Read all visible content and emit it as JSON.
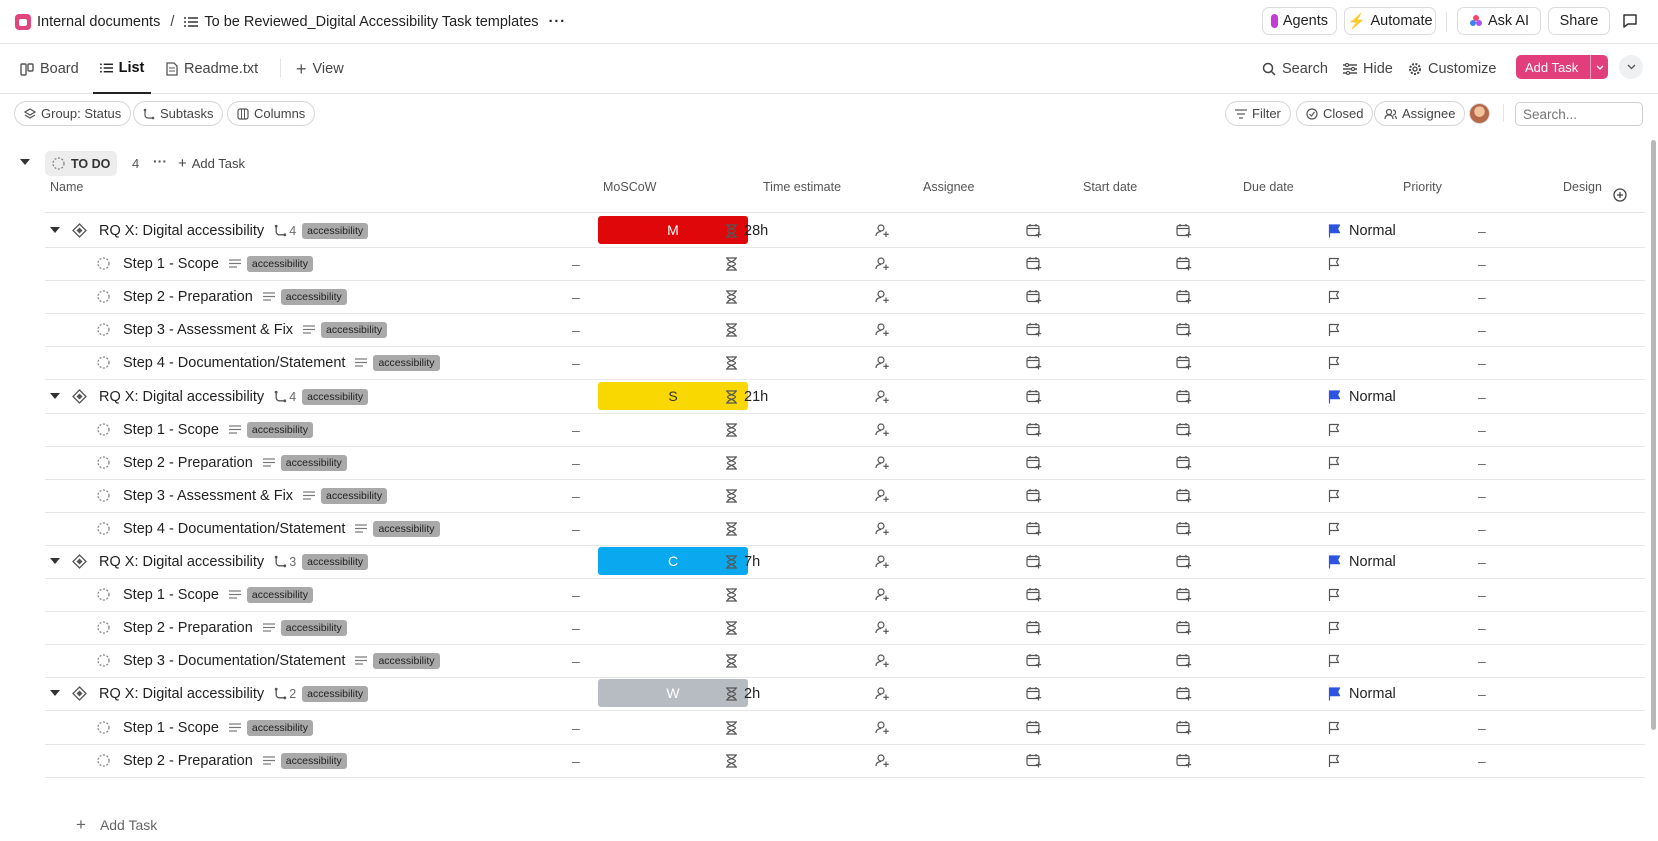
{
  "breadcrumb": {
    "workspace": "Internal documents",
    "separator": "/",
    "list": "To be Reviewed_Digital Accessibility Task templates",
    "more": "···"
  },
  "topbar": {
    "agents": "Agents",
    "automate": "Automate",
    "ask_ai": "Ask AI",
    "share": "Share"
  },
  "tabs": [
    {
      "label": "Board"
    },
    {
      "label": "List"
    },
    {
      "label": "Readme.txt"
    },
    {
      "label": "View"
    }
  ],
  "toolbar": {
    "search": "Search",
    "hide": "Hide",
    "customize": "Customize",
    "add_task": "Add Task"
  },
  "filters": {
    "group": "Group: Status",
    "subtasks": "Subtasks",
    "columns": "Columns",
    "filter": "Filter",
    "closed": "Closed",
    "assignee": "Assignee",
    "search_placeholder": "Search..."
  },
  "group": {
    "status": "TO DO",
    "count": "4",
    "add_task": "Add Task"
  },
  "columns": [
    "Name",
    "MoSCoW",
    "Time estimate",
    "Assignee",
    "Start date",
    "Due date",
    "Priority",
    "Design"
  ],
  "colors": {
    "accent": "#e23e7c",
    "must": "#e0070a",
    "should": "#f8d800",
    "could": "#0aa9ef",
    "wont": "#b7bcc3",
    "flag": "#2d54e0"
  },
  "tasks": [
    {
      "name": "RQ X: Digital accessibility",
      "subcount": "4",
      "tag": "accessibility",
      "moscow": "M",
      "moscow_color": "#e0070a",
      "estimate": "28h",
      "priority": "Normal",
      "design": "–",
      "subtasks": [
        {
          "name": "Step 1 - Scope",
          "tag": "accessibility",
          "moscow": "–",
          "design": "–"
        },
        {
          "name": "Step 2 - Preparation",
          "tag": "accessibility",
          "moscow": "–",
          "design": "–"
        },
        {
          "name": "Step 3 - Assessment & Fix",
          "tag": "accessibility",
          "moscow": "–",
          "design": "–"
        },
        {
          "name": "Step 4 - Documentation/Statement",
          "tag": "accessibility",
          "moscow": "–",
          "design": "–"
        }
      ]
    },
    {
      "name": "RQ X: Digital accessibility",
      "subcount": "4",
      "tag": "accessibility",
      "moscow": "S",
      "moscow_color": "#f8d800",
      "estimate": "21h",
      "priority": "Normal",
      "design": "–",
      "subtasks": [
        {
          "name": "Step 1 - Scope",
          "tag": "accessibility",
          "moscow": "–",
          "design": "–"
        },
        {
          "name": "Step 2 - Preparation",
          "tag": "accessibility",
          "moscow": "–",
          "design": "–"
        },
        {
          "name": "Step 3 - Assessment & Fix",
          "tag": "accessibility",
          "moscow": "–",
          "design": "–"
        },
        {
          "name": "Step 4 - Documentation/Statement",
          "tag": "accessibility",
          "moscow": "–",
          "design": "–"
        }
      ]
    },
    {
      "name": "RQ X: Digital accessibility",
      "subcount": "3",
      "tag": "accessibility",
      "moscow": "C",
      "moscow_color": "#0aa9ef",
      "estimate": "7h",
      "priority": "Normal",
      "design": "–",
      "subtasks": [
        {
          "name": "Step 1 - Scope",
          "tag": "accessibility",
          "moscow": "–",
          "design": "–"
        },
        {
          "name": "Step 2 - Preparation",
          "tag": "accessibility",
          "moscow": "–",
          "design": "–"
        },
        {
          "name": "Step 3 - Documentation/Statement",
          "tag": "accessibility",
          "moscow": "–",
          "design": "–"
        }
      ]
    },
    {
      "name": "RQ X: Digital accessibility",
      "subcount": "2",
      "tag": "accessibility",
      "moscow": "W",
      "moscow_color": "#b7bcc3",
      "estimate": "2h",
      "priority": "Normal",
      "design": "–",
      "subtasks": [
        {
          "name": "Step 1 - Scope",
          "tag": "accessibility",
          "moscow": "–",
          "design": "–"
        },
        {
          "name": "Step 2 - Preparation",
          "tag": "accessibility",
          "moscow": "–",
          "design": "–"
        }
      ]
    }
  ],
  "footer": {
    "add_task": "Add Task"
  }
}
